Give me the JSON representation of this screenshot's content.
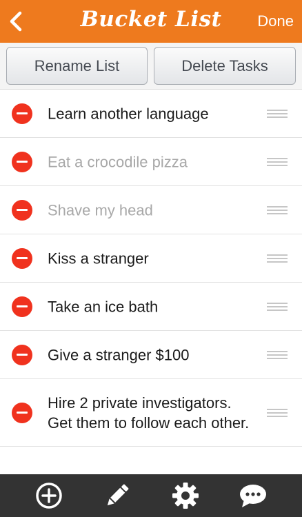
{
  "header": {
    "back_icon": "chevron-left-icon",
    "title": "Bucket List",
    "done_label": "Done"
  },
  "actions": {
    "rename_label": "Rename List",
    "delete_label": "Delete Tasks"
  },
  "tasks": [
    {
      "text": "Learn another language",
      "completed": false
    },
    {
      "text": "Eat a crocodile pizza",
      "completed": true
    },
    {
      "text": "Shave my head",
      "completed": true
    },
    {
      "text": "Kiss a stranger",
      "completed": false
    },
    {
      "text": "Take an ice bath",
      "completed": false
    },
    {
      "text": "Give a stranger $100",
      "completed": false
    },
    {
      "text": "Hire 2 private investigators. Get them to follow each other.",
      "completed": false
    }
  ],
  "toolbar": {
    "icons": [
      "plus-circle-icon",
      "pencil-icon",
      "gear-icon",
      "chat-bubble-icon"
    ]
  },
  "colors": {
    "header": "#ee7a1e",
    "delete": "#f0321e",
    "toolbar": "#333333",
    "completed_text": "#a8a8a8"
  }
}
